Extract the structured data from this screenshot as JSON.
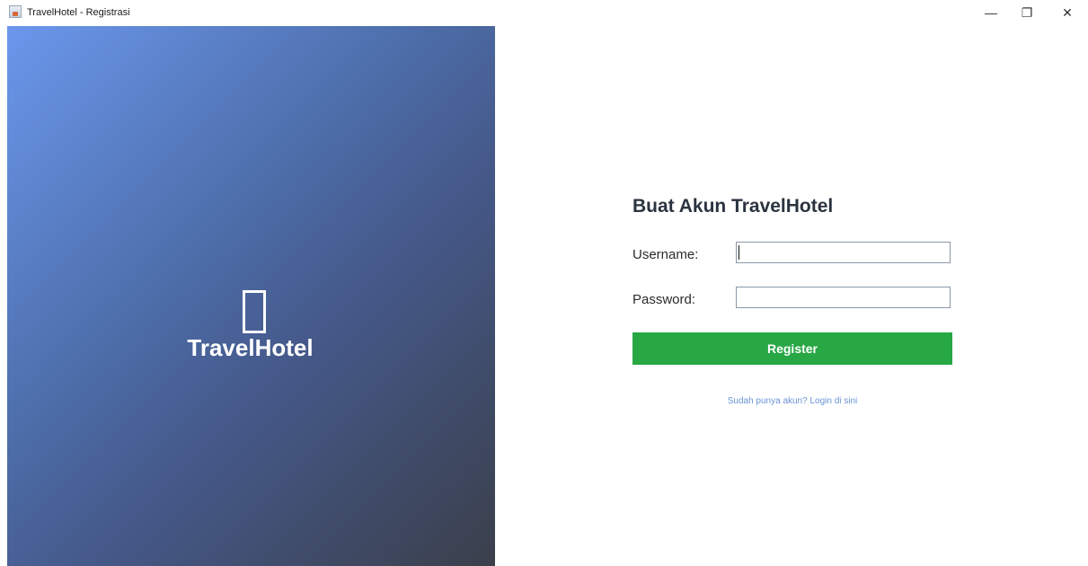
{
  "window": {
    "title": "TravelHotel - Registrasi",
    "controls": {
      "minimize": "—",
      "maximize": "❐",
      "close": "✕"
    }
  },
  "branding": {
    "icon": "hotel-icon",
    "name": "TravelHotel",
    "gradient_start": "#6b97ec",
    "gradient_end": "#3a3f4a"
  },
  "form": {
    "title": "Buat Akun TravelHotel",
    "username_label": "Username:",
    "username_value": "",
    "password_label": "Password:",
    "password_value": "",
    "register_label": "Register",
    "register_color": "#28a745",
    "login_link": "Sudah punya akun? Login di sini",
    "link_color": "#6a93d6"
  }
}
